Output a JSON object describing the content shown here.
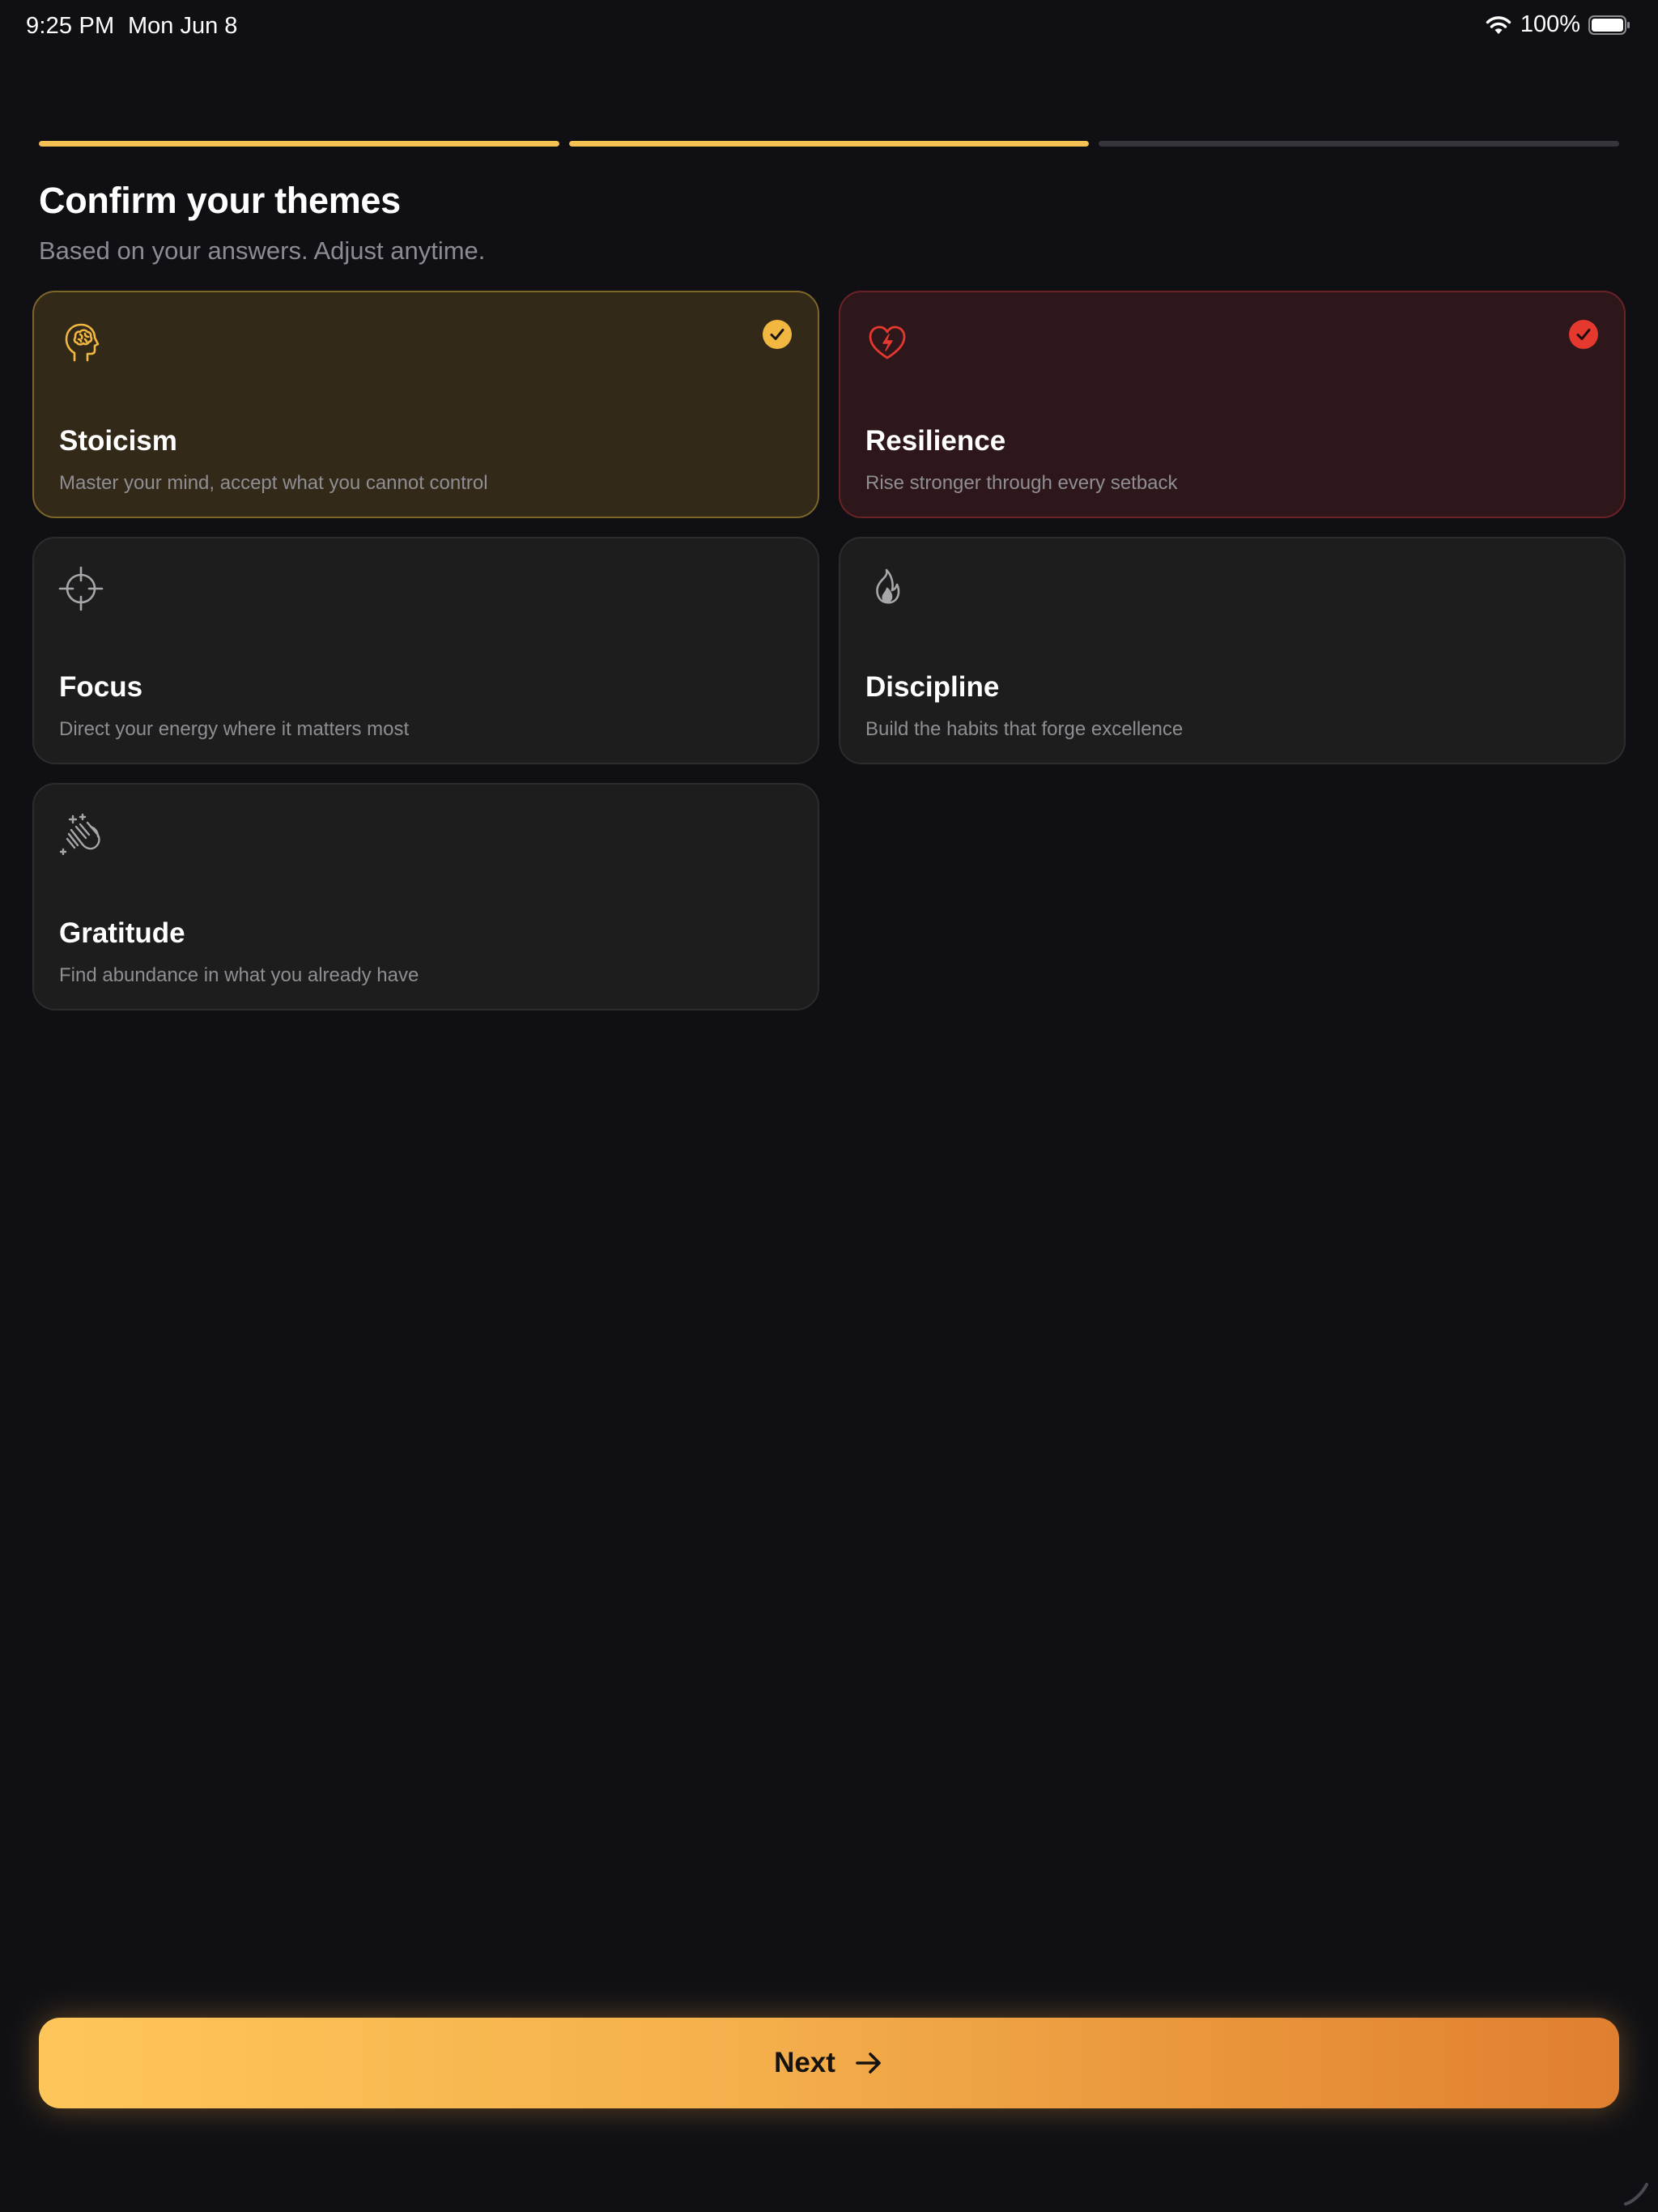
{
  "status_bar": {
    "time": "9:25 PM",
    "date": "Mon Jun 8",
    "battery": "100%",
    "icons": [
      "wifi-icon",
      "battery-icon"
    ]
  },
  "progress": {
    "steps": [
      {
        "fill": 1.0
      },
      {
        "fill": 1.0
      },
      {
        "fill": 0.0
      }
    ]
  },
  "header": {
    "title": "Confirm your themes",
    "subtitle": "Based on your answers. Adjust anytime."
  },
  "themes": [
    {
      "name": "Stoicism",
      "description": "Master your mind, accept what you cannot control",
      "icon": "head-brain-icon",
      "selected": true,
      "accent": "#f2b740"
    },
    {
      "name": "Resilience",
      "description": "Rise stronger through every setback",
      "icon": "heart-bolt-icon",
      "selected": true,
      "accent": "#e5392f"
    },
    {
      "name": "Focus",
      "description": "Direct your energy where it matters most",
      "icon": "crosshair-icon",
      "selected": false,
      "accent": "#a7a7ab"
    },
    {
      "name": "Discipline",
      "description": "Build the habits that forge excellence",
      "icon": "flame-icon",
      "selected": false,
      "accent": "#a7a7ab"
    },
    {
      "name": "Gratitude",
      "description": "Find abundance in what you already have",
      "icon": "clapping-hands-icon",
      "selected": false,
      "accent": "#a7a7ab"
    }
  ],
  "footer": {
    "next_label": "Next",
    "next_icon": "arrow-right-icon"
  },
  "colors": {
    "background": "#101014",
    "gold": "#f2b740",
    "red": "#e5392f",
    "progress_active": "#f6c153",
    "progress_inactive": "#35353b"
  }
}
